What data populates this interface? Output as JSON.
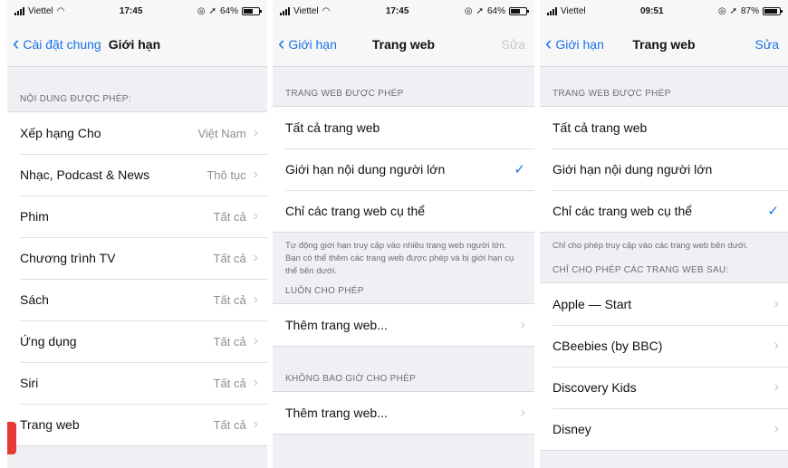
{
  "screen1": {
    "status": {
      "carrier": "Viettel",
      "time": "17:45",
      "battery": "64%",
      "battery_level": 0.64
    },
    "nav": {
      "back_label": "Cài đặt chung",
      "title": "Giới hạn"
    },
    "section_header": "NỘI DUNG ĐƯỢC PHÉP:",
    "rows": [
      {
        "label": "Xếp hạng Cho",
        "value": "Việt Nam"
      },
      {
        "label": "Nhạc, Podcast & News",
        "value": "Thô tục"
      },
      {
        "label": "Phim",
        "value": "Tất cả"
      },
      {
        "label": "Chương trình TV",
        "value": "Tất cả"
      },
      {
        "label": "Sách",
        "value": "Tất cả"
      },
      {
        "label": "Ứng dụng",
        "value": "Tất cả"
      },
      {
        "label": "Siri",
        "value": "Tất cả"
      },
      {
        "label": "Trang web",
        "value": "Tất cả"
      }
    ]
  },
  "screen2": {
    "status": {
      "carrier": "Viettel",
      "time": "17:45",
      "battery": "64%",
      "battery_level": 0.64
    },
    "nav": {
      "back_label": "Giới hạn",
      "title": "Trang web",
      "edit_label": "Sửa"
    },
    "section_header": "TRANG WEB ĐƯỢC PHÉP",
    "options": [
      {
        "label": "Tất cả trang web"
      },
      {
        "label": "Giới hạn nội dung người lớn",
        "check": "✓"
      },
      {
        "label": "Chỉ các trang web cụ thể"
      }
    ],
    "note": "Tự động giới hạn truy cập vào nhiều trang web người lớn. Bạn có thể thêm các trang web được phép và bị giới hạn cụ thể bên dưới.",
    "always_header": "LUÔN CHO PHÉP",
    "always_row": "Thêm trang web...",
    "never_header": "KHÔNG BAO GIỜ CHO PHÉP",
    "never_row": "Thêm trang web..."
  },
  "screen3": {
    "status": {
      "carrier": "Viettel",
      "time": "09:51",
      "battery": "87%",
      "battery_level": 0.87
    },
    "nav": {
      "back_label": "Giới hạn",
      "title": "Trang web",
      "edit_label": "Sửa"
    },
    "section_header": "TRANG WEB ĐƯỢC PHÉP",
    "options": [
      {
        "label": "Tất cả trang web"
      },
      {
        "label": "Giới hạn nội dung người lớn"
      },
      {
        "label": "Chỉ các trang web cụ thể",
        "check": "✓"
      }
    ],
    "note": "Chỉ cho phép truy cập vào các trang web bên dưới.",
    "sites_header": "CHỈ CHO PHÉP CÁC TRANG WEB SAU:",
    "sites": [
      {
        "label": "Apple — Start"
      },
      {
        "label": "CBeebies (by BBC)"
      },
      {
        "label": "Discovery Kids"
      },
      {
        "label": "Disney"
      }
    ]
  },
  "icons": {
    "back": "chevron-left-icon",
    "arrow": "chevron-right-icon",
    "check": "checkmark-icon",
    "wifi": "wifi-icon",
    "signal": "signal-icon",
    "battery": "battery-icon",
    "location": "location-arrow-icon",
    "alarm": "alarm-icon"
  },
  "colors": {
    "accent": "#1a73e8",
    "background": "#efeff4",
    "secondary_text": "#8e8e93"
  }
}
